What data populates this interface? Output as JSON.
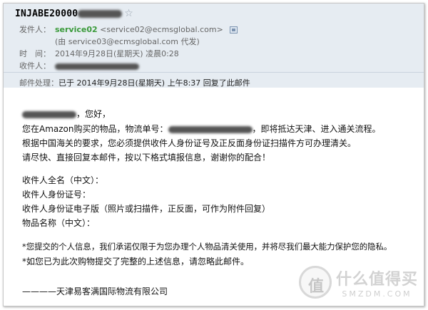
{
  "email": {
    "subject": "INJABE20000",
    "from_label": "发件人：",
    "from_name": "service02",
    "from_address": "<service02@ecmsglobal.com>",
    "on_behalf": "(由 service03@ecmsglobal.com 代发)",
    "time_label": "时　间：",
    "time": "2014年9月28日(星期天) 凌晨0:28",
    "to_label": "收件人：",
    "process_label": "邮件处理：",
    "process_text": "已于 2014年9月28日(星期天) 上午8:37 回复了此邮件"
  },
  "body": {
    "greeting_suffix": "，您好，",
    "line1_pre": "您在Amazon购买的物品，物流单号：",
    "line1_post": "，即将抵达天津、进入通关流程。",
    "line2": "根据中国海关的要求，您必须提供收件人身份证号及正反面身份证扫描件方可办理清关。",
    "line3": "请尽快、直接回复本邮件，按以下格式填报信息，谢谢你的配合！",
    "fields": [
      "收件人全名（中文）：",
      "收件人身份证号：",
      "收件人身份证电子版（照片或扫描件，正反面，可作为附件回复）",
      "物品名称（中文）："
    ],
    "note1": "*您提交的个人信息，我们承诺仅限于为您办理个人物品清关使用，并将尽我们最大能力保护您的隐私。",
    "note2": "*如您已为此次购物提交了完整的上述信息，请忽略此邮件。",
    "signature": "————天津易客满国际物流有限公司"
  },
  "watermark": {
    "glyph": "值",
    "title": "什么值得买",
    "site": "SMZDM.COM"
  }
}
